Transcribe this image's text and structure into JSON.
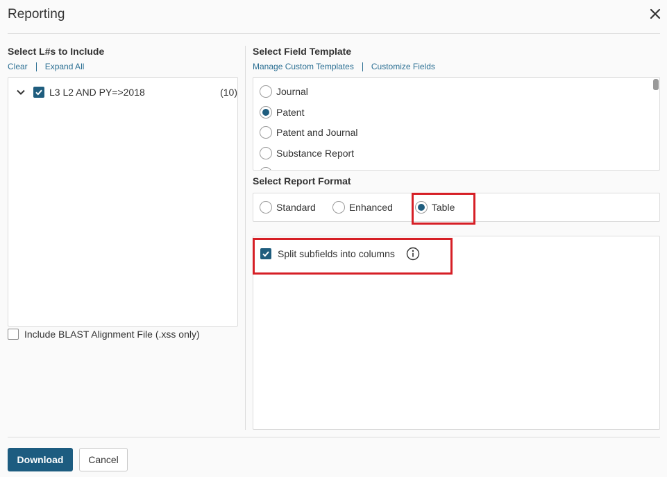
{
  "dialog": {
    "title": "Reporting"
  },
  "left": {
    "section_title": "Select L#s to Include",
    "links": {
      "clear": "Clear",
      "expand_all": "Expand All"
    },
    "tree": [
      {
        "label": "L3  L2 AND PY=>2018",
        "count": "(10)",
        "checked": true,
        "expanded": true
      }
    ],
    "include_blast": {
      "label": "Include BLAST Alignment File (.xss only)",
      "checked": false
    }
  },
  "right": {
    "template_title": "Select Field Template",
    "template_links": {
      "manage": "Manage Custom Templates",
      "customize": "Customize Fields"
    },
    "templates": [
      {
        "label": "Journal",
        "selected": false
      },
      {
        "label": "Patent",
        "selected": true
      },
      {
        "label": "Patent and Journal",
        "selected": false
      },
      {
        "label": "Substance Report",
        "selected": false
      }
    ],
    "format_title": "Select Report Format",
    "formats": [
      {
        "label": "Standard",
        "selected": false
      },
      {
        "label": "Enhanced",
        "selected": false
      },
      {
        "label": "Table",
        "selected": true
      }
    ],
    "split_subfields": {
      "label": "Split subfields into columns",
      "checked": true
    }
  },
  "footer": {
    "download": "Download",
    "cancel": "Cancel"
  },
  "colors": {
    "accent": "#1d5c80",
    "link": "#2b6f93",
    "highlight": "#d61f26"
  },
  "icons": {
    "close": "close-icon",
    "chevron": "chevron-down-icon",
    "info": "info-icon"
  }
}
